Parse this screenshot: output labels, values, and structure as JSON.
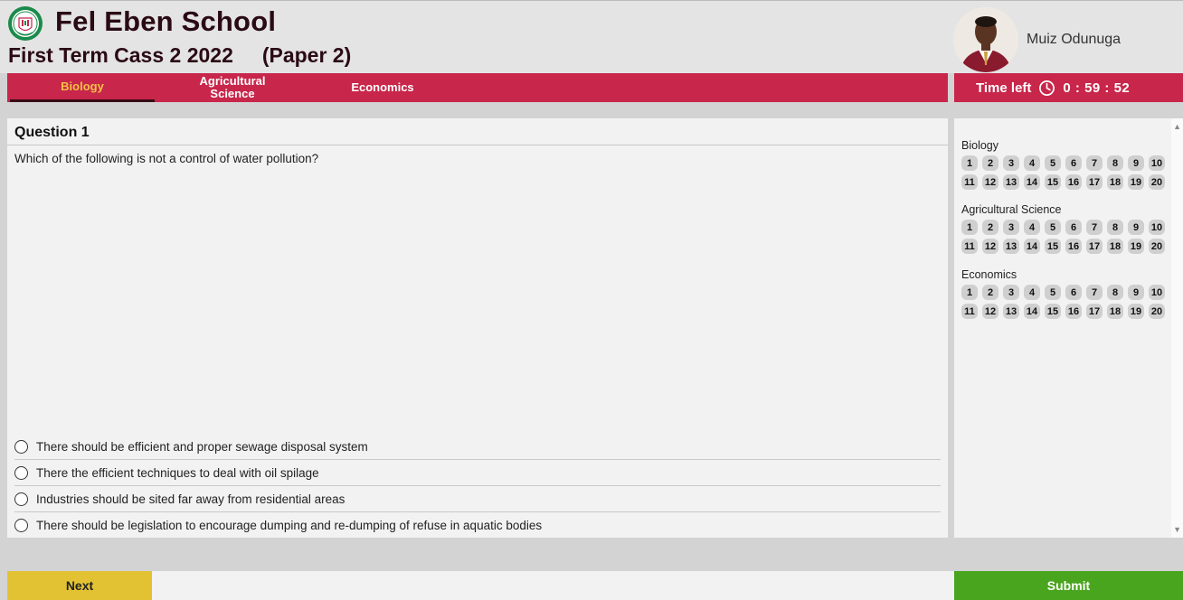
{
  "header": {
    "school_name": "Fel Eben School",
    "exam_title": "First Term Cass 2 2022     (Paper 2)"
  },
  "user": {
    "name": "Muiz Odunuga"
  },
  "tabs": [
    {
      "label": "Biology",
      "active": true
    },
    {
      "label": "Agricultural Science",
      "active": false
    },
    {
      "label": "Economics",
      "active": false
    }
  ],
  "timer": {
    "label": "Time left",
    "value": "0 : 59 : 52",
    "icon": "clock-icon"
  },
  "question": {
    "title": "Question 1",
    "text": "Which of the following is not a control of water pollution?",
    "options": [
      "There should be efficient and proper sewage disposal system",
      "There the efficient techniques to deal with oil spilage",
      "Industries should be sited far away from residential areas",
      "There should be legislation to encourage dumping and re-dumping of refuse in aquatic bodies"
    ]
  },
  "navigator": {
    "subjects": [
      {
        "name": "Biology",
        "numbers": [
          "1",
          "2",
          "3",
          "4",
          "5",
          "6",
          "7",
          "8",
          "9",
          "10",
          "11",
          "12",
          "13",
          "14",
          "15",
          "16",
          "17",
          "18",
          "19",
          "20"
        ]
      },
      {
        "name": "Agricultural Science",
        "numbers": [
          "1",
          "2",
          "3",
          "4",
          "5",
          "6",
          "7",
          "8",
          "9",
          "10",
          "11",
          "12",
          "13",
          "14",
          "15",
          "16",
          "17",
          "18",
          "19",
          "20"
        ]
      },
      {
        "name": "Economics",
        "numbers": [
          "1",
          "2",
          "3",
          "4",
          "5",
          "6",
          "7",
          "8",
          "9",
          "10",
          "11",
          "12",
          "13",
          "14",
          "15",
          "16",
          "17",
          "18",
          "19",
          "20"
        ]
      }
    ]
  },
  "buttons": {
    "next": "Next",
    "submit": "Submit"
  },
  "colors": {
    "brand": "#c8264a",
    "active_tab": "#f5c244",
    "next": "#e2c233",
    "submit": "#4aa51e"
  }
}
